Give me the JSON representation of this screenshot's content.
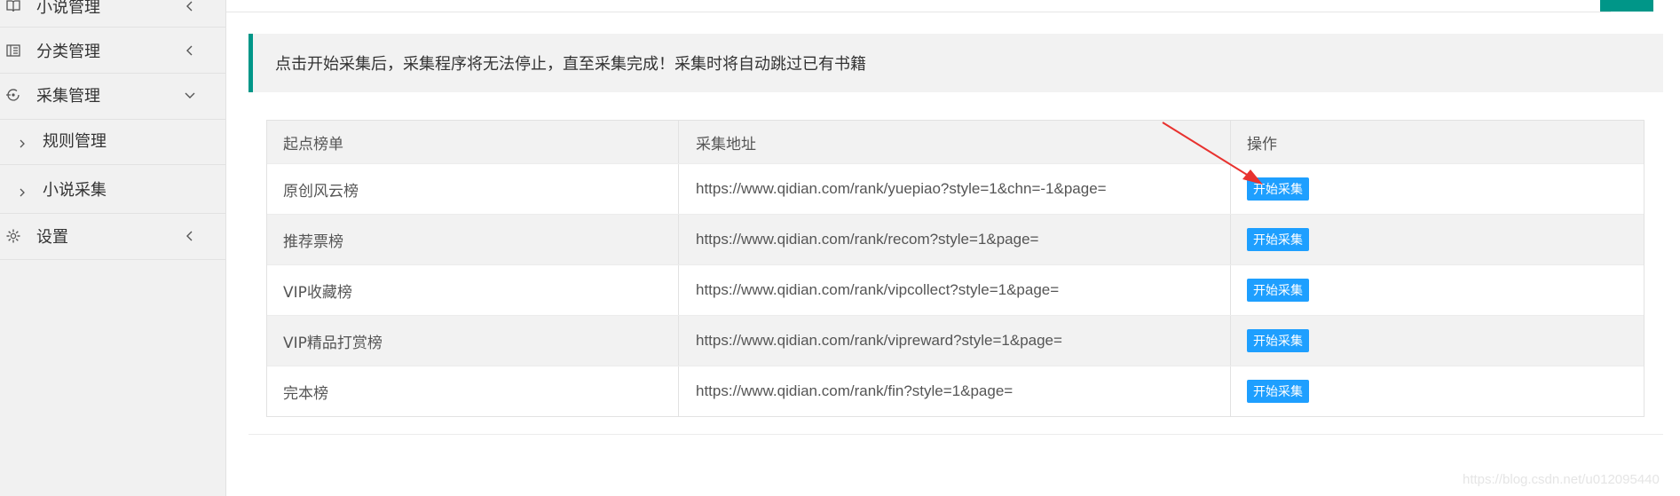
{
  "sidebar": {
    "items": [
      {
        "label": "小说管理",
        "icon": "book-icon"
      },
      {
        "label": "分类管理",
        "icon": "category-icon"
      },
      {
        "label": "采集管理",
        "icon": "collect-icon"
      },
      {
        "label": "规则管理"
      },
      {
        "label": "小说采集"
      },
      {
        "label": "设置",
        "icon": "gear-icon"
      }
    ]
  },
  "notice": {
    "text": "点击开始采集后，采集程序将无法停止，直至采集完成！采集时将自动跳过已有书籍"
  },
  "table": {
    "headers": [
      "起点榜单",
      "采集地址",
      "操作"
    ],
    "rows": [
      {
        "name": "原创风云榜",
        "url": "https://www.qidian.com/rank/yuepiao?style=1&chn=-1&page=",
        "action": "开始采集"
      },
      {
        "name": "推荐票榜",
        "url": "https://www.qidian.com/rank/recom?style=1&page=",
        "action": "开始采集"
      },
      {
        "name": "VIP收藏榜",
        "url": "https://www.qidian.com/rank/vipcollect?style=1&page=",
        "action": "开始采集"
      },
      {
        "name": "VIP精品打赏榜",
        "url": "https://www.qidian.com/rank/vipreward?style=1&page=",
        "action": "开始采集"
      },
      {
        "name": "完本榜",
        "url": "https://www.qidian.com/rank/fin?style=1&page=",
        "action": "开始采集"
      }
    ]
  },
  "watermark": "https://blog.csdn.net/u012095440",
  "colors": {
    "accent": "#009688",
    "button": "#1e9fff",
    "annotation_arrow": "#e8322f"
  }
}
